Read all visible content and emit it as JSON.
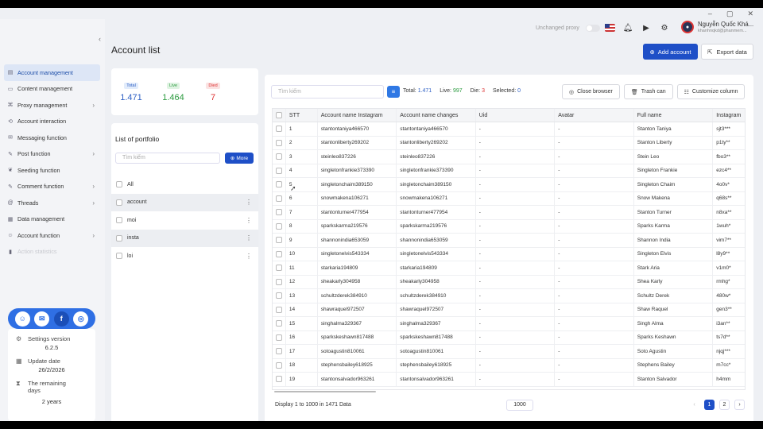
{
  "window": {
    "minimize": "–",
    "maximize": "▢",
    "close": "✕"
  },
  "sidebar": {
    "items": [
      {
        "label": "Account management",
        "icon": "person-list-icon",
        "active": true
      },
      {
        "label": "Content management",
        "icon": "document-icon"
      },
      {
        "label": "Proxy management",
        "icon": "network-icon",
        "chevron": true
      },
      {
        "label": "Account interaction",
        "icon": "interaction-icon"
      },
      {
        "label": "Messaging function",
        "icon": "message-icon"
      },
      {
        "label": "Post function",
        "icon": "post-icon",
        "chevron": true
      },
      {
        "label": "Seeding function",
        "icon": "seed-icon"
      },
      {
        "label": "Comment function",
        "icon": "comment-icon",
        "chevron": true
      },
      {
        "label": "Threads",
        "icon": "threads-icon",
        "chevron": true
      },
      {
        "label": "Data management",
        "icon": "data-icon"
      },
      {
        "label": "Account function",
        "icon": "account-icon",
        "chevron": true
      },
      {
        "label": "Action statistics",
        "icon": "stats-icon",
        "faded": true
      }
    ],
    "settings_label": "Settings version",
    "settings_value": "6.2.5",
    "update_label": "Update date",
    "update_value": "26/2/2026",
    "remaining_label": "The remaining days",
    "remaining_value": "2 years"
  },
  "topbar": {
    "proxy_label": "Unchanged proxy",
    "user_name": "Nguyễn Quốc Khá...",
    "user_email": "khanhnqkd@phanmem..."
  },
  "page_title": "Account list",
  "buttons": {
    "add": "Add account",
    "export": "Export data"
  },
  "stats": {
    "total_label": "Total",
    "total": "1.471",
    "live_label": "Live",
    "live": "1.464",
    "died_label": "Died",
    "died": "7"
  },
  "portfolio": {
    "title": "List of portfolio",
    "search_placeholder": "Tìm kiếm",
    "more": "More",
    "all": "All",
    "items": [
      "account",
      "moi",
      "insta",
      "loi"
    ]
  },
  "toolbar": {
    "search_placeholder": "Tìm kiếm",
    "total_label": "Total:",
    "total": "1.471",
    "live_label": "Live:",
    "live": "997",
    "die_label": "Die:",
    "die": "3",
    "selected_label": "Selected:",
    "selected": "0",
    "close_browser": "Close browser",
    "trash": "Trash can",
    "customize": "Customize column"
  },
  "table": {
    "headers": [
      "STT",
      "Account name Instagram",
      "Account name changes",
      "Uid",
      "Avatar",
      "Full name",
      "Instagram"
    ],
    "rows": [
      [
        "1",
        "stantontaniya466570",
        "stantontaniya466570",
        "-",
        "-",
        "Stanton Taniya",
        "sjt3***"
      ],
      [
        "2",
        "stantonliberty269202",
        "stantonliberty269202",
        "-",
        "-",
        "Stanton Liberty",
        "p1ty**"
      ],
      [
        "3",
        "steinleo837226",
        "steinleo837226",
        "-",
        "-",
        "Stein Leo",
        "fbo3**"
      ],
      [
        "4",
        "singletonfrankie373390",
        "singletonfrankie373390",
        "-",
        "-",
        "Singleton Frankie",
        "ezc4**"
      ],
      [
        "5",
        "singletonchaim389150",
        "singletonchaim389150",
        "-",
        "-",
        "Singleton Chaim",
        "4o0v*"
      ],
      [
        "6",
        "snowmakena106271",
        "snowmakena106271",
        "-",
        "-",
        "Snow Makena",
        "q68s**"
      ],
      [
        "7",
        "stantonturner477954",
        "stantonturner477954",
        "-",
        "-",
        "Stanton Turner",
        "n8xa**"
      ],
      [
        "8",
        "sparkskarma219576",
        "sparkskarma219576",
        "-",
        "-",
        "Sparks Karma",
        "1wuh*"
      ],
      [
        "9",
        "shannonindia653059",
        "shannonindia653059",
        "-",
        "-",
        "Shannon India",
        "vim7**"
      ],
      [
        "10",
        "singletonelvis543334",
        "singletonelvis543334",
        "-",
        "-",
        "Singleton Elvis",
        "l8y9**"
      ],
      [
        "11",
        "starkaria194809",
        "starkaria194809",
        "-",
        "-",
        "Stark Aria",
        "v1m0*"
      ],
      [
        "12",
        "sheakarly304958",
        "sheakarly304958",
        "-",
        "-",
        "Shea Karly",
        "rmhg*"
      ],
      [
        "13",
        "schultzderek384910",
        "schultzderek384910",
        "-",
        "-",
        "Schultz Derek",
        "480w*"
      ],
      [
        "14",
        "shawraquel972507",
        "shawraquel972507",
        "-",
        "-",
        "Shaw Raquel",
        "gen3**"
      ],
      [
        "15",
        "singhalma329367",
        "singhalma329367",
        "-",
        "-",
        "Singh Alma",
        "i3an**"
      ],
      [
        "16",
        "sparkskeshawn817488",
        "sparkskeshawn817488",
        "-",
        "-",
        "Sparks Keshawn",
        "ts7d**"
      ],
      [
        "17",
        "sotoagustin810061",
        "sotoagustin810061",
        "-",
        "-",
        "Soto Agustin",
        "njqj***"
      ],
      [
        "18",
        "stephensbailey618925",
        "stephensbailey618925",
        "-",
        "-",
        "Stephens Bailey",
        "m7cc*"
      ],
      [
        "19",
        "stantonsalvador963261",
        "stantonsalvador963261",
        "-",
        "-",
        "Stanton Salvador",
        "h4mm"
      ]
    ]
  },
  "footer": {
    "display": "Display 1 to 1000 in 1471 Data",
    "page_size": "1000",
    "pages": [
      "1",
      "2"
    ],
    "prev": "‹",
    "next": "›"
  }
}
